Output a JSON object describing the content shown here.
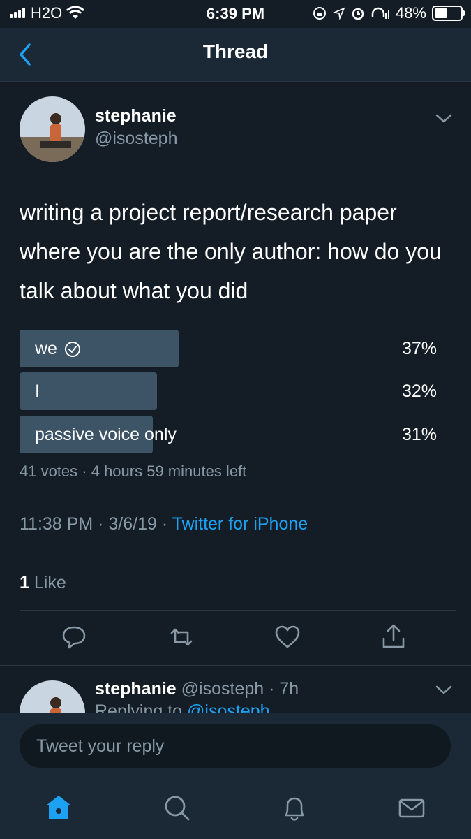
{
  "status_bar": {
    "carrier": "H2O",
    "time": "6:39 PM",
    "battery": "48%"
  },
  "header": {
    "title": "Thread"
  },
  "tweet": {
    "name": "stephanie",
    "handle": "@isosteph",
    "text": "writing a project report/research paper where you are the only author: how do you talk about what you did",
    "poll": {
      "options": [
        {
          "label": "we",
          "percent_text": "37%",
          "percent": 37,
          "selected": true
        },
        {
          "label": "I",
          "percent_text": "32%",
          "percent": 32,
          "selected": false
        },
        {
          "label": "passive voice only",
          "percent_text": "31%",
          "percent": 31,
          "selected": false
        }
      ],
      "summary": "41 votes · 4 hours 59 minutes left"
    },
    "timestamp": "11:38 PM · 3/6/19 · ",
    "source": "Twitter for iPhone",
    "likes_count": "1",
    "likes_label": "Like"
  },
  "reply_preview": {
    "name": "stephanie",
    "handle_time": "@isosteph · 7h",
    "replying_label": "Replying to ",
    "replying_handle": "@isosteph"
  },
  "reply_box": {
    "placeholder": "Tweet your reply"
  },
  "icons": {
    "back": "chevron-left-icon",
    "more": "chevron-down-icon",
    "reply": "reply-icon",
    "retweet": "retweet-icon",
    "like": "heart-icon",
    "share": "share-icon",
    "home": "home-icon",
    "search": "search-icon",
    "notifications": "bell-icon",
    "messages": "mail-icon"
  },
  "colors": {
    "background": "#141d26",
    "accent": "#1da1f2",
    "poll_bar": "#3d5466",
    "secondary_text": "#8899a6"
  }
}
